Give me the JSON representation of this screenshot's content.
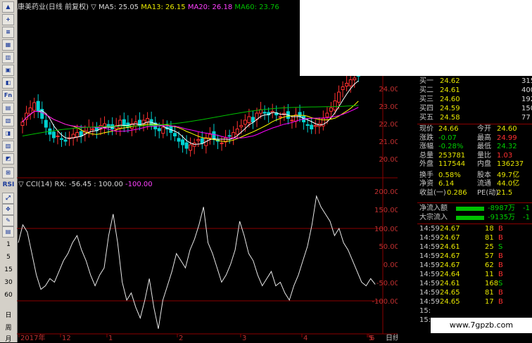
{
  "title_bar": {
    "stock": "康美药业(日线 前复权)",
    "ma5": "▽ MA5: 25.05",
    "ma13": "MA13: 26.15",
    "ma20": "MA20: 26.18",
    "ma60": "MA60: 23.76"
  },
  "indicator_bar": {
    "name": "▽ CCI(14)",
    "values": "RX: -56.45 : 100.00",
    "neg": "-100.00"
  },
  "toolbar": {
    "labels": [
      "RSI",
      "1",
      "5",
      "15",
      "30",
      "60",
      "日",
      "周",
      "月"
    ]
  },
  "price_axis": [
    "24.00",
    "23.00",
    "22.00",
    "21.00",
    "20.00"
  ],
  "cci_axis": [
    "200.00",
    "150.00",
    "100.00",
    "50.00",
    "0.00",
    "-50.00",
    "-100.00"
  ],
  "x_axis": [
    "2017年",
    "12",
    "1",
    "2",
    "3",
    "4",
    "5",
    "6"
  ],
  "x_axis_right": "日线",
  "quote": {
    "bids": [
      {
        "label": "买一",
        "price": "24.62",
        "vol": "315"
      },
      {
        "label": "买二",
        "price": "24.61",
        "vol": "400"
      },
      {
        "label": "买三",
        "price": "24.60",
        "vol": "192"
      },
      {
        "label": "买四",
        "price": "24.59",
        "vol": "150"
      },
      {
        "label": "买五",
        "price": "24.58",
        "vol": "77"
      }
    ],
    "rows": [
      {
        "l1": "现价",
        "v1": "24.66",
        "l2": "今开",
        "v2": "24.60"
      },
      {
        "l1": "涨跌",
        "v1": "-0.07",
        "l2": "最高",
        "v2": "24.99"
      },
      {
        "l1": "涨幅",
        "v1": "-0.28%",
        "l2": "最低",
        "v2": "24.32"
      },
      {
        "l1": "总量",
        "v1": "253781",
        "l2": "量比",
        "v2": "1.03"
      },
      {
        "l1": "外盘",
        "v1": "117544",
        "l2": "内盘",
        "v2": "136237"
      },
      {
        "l1": "换手",
        "v1": "0.58%",
        "l2": "股本",
        "v2": "49.7亿"
      },
      {
        "l1": "净资",
        "v1": "6.14",
        "l2": "流通",
        "v2": "44.0亿"
      },
      {
        "l1": "收益(一)",
        "v1": "0.286",
        "l2": "PE(动)",
        "v2": "21.5"
      }
    ],
    "flows": [
      {
        "label": "净流入额",
        "value": "-8987万",
        "tail": "-1"
      },
      {
        "label": "大宗流入",
        "value": "-9135万",
        "tail": "-1"
      }
    ],
    "ticks": [
      {
        "time": "14:59",
        "price": "24.67",
        "vol": "18",
        "side": "B"
      },
      {
        "time": "14:59",
        "price": "24.67",
        "vol": "81",
        "side": "B"
      },
      {
        "time": "14:59",
        "price": "24.61",
        "vol": "25",
        "side": "S"
      },
      {
        "time": "14:59",
        "price": "24.67",
        "vol": "57",
        "side": "B"
      },
      {
        "time": "14:59",
        "price": "24.67",
        "vol": "62",
        "side": "B"
      },
      {
        "time": "14:59",
        "price": "24.64",
        "vol": "11",
        "side": "B"
      },
      {
        "time": "14:59",
        "price": "24.61",
        "vol": "168",
        "side": "S"
      },
      {
        "time": "14:59",
        "price": "24.65",
        "vol": "81",
        "side": "B"
      },
      {
        "time": "14:59",
        "price": "24.65",
        "vol": "17",
        "side": "B"
      },
      {
        "time": "15:",
        "price": "",
        "vol": "",
        "side": ""
      },
      {
        "time": "15:",
        "price": "",
        "vol": "",
        "side": ""
      }
    ]
  },
  "watermark": "www.7gpzb.com",
  "colors": {
    "up": "#ff3030",
    "down": "#00d0d0",
    "ma5": "#ffffff",
    "ma13": "#ffff00",
    "ma20": "#ff00ff",
    "ma60": "#00c000",
    "grid": "#8b0000"
  }
}
